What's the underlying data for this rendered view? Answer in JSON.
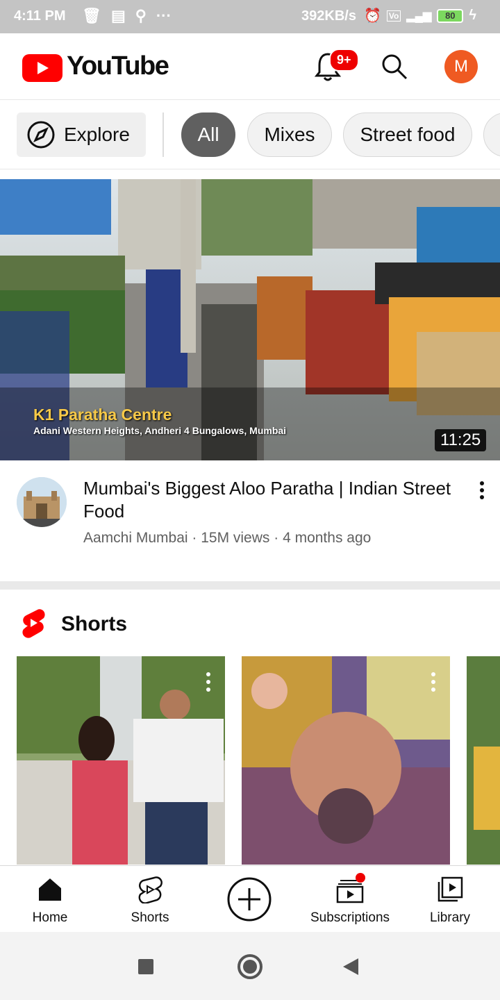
{
  "status_bar": {
    "time": "4:11 PM",
    "net_speed": "392KB/s",
    "battery": "80",
    "icons": [
      "trash-icon",
      "message-icon",
      "person-icon",
      "more-dots-icon",
      "alarm-icon",
      "volte-icon",
      "signal-icon",
      "battery-icon",
      "charging-icon"
    ]
  },
  "header": {
    "logo_text": "YouTube",
    "notification_badge": "9+",
    "avatar_letter": "M",
    "brand_color": "#ff0000",
    "avatar_color": "#ef5a22"
  },
  "chips": {
    "explore_label": "Explore",
    "items": [
      {
        "label": "All",
        "active": true
      },
      {
        "label": "Mixes",
        "active": false
      },
      {
        "label": "Street food",
        "active": false
      }
    ]
  },
  "video": {
    "thumbnail_title": "K1 Paratha Centre",
    "thumbnail_subtitle": "Adani Western Heights, Andheri 4 Bungalows, Mumbai",
    "duration": "11:25",
    "title": "Mumbai's Biggest Aloo Paratha | Indian Street Food",
    "meta": "Aamchi Mumbai · 15M views · 4 months ago"
  },
  "shorts": {
    "title": "Shorts"
  },
  "bottom_nav": {
    "home": "Home",
    "shorts": "Shorts",
    "subscriptions": "Subscriptions",
    "library": "Library"
  }
}
